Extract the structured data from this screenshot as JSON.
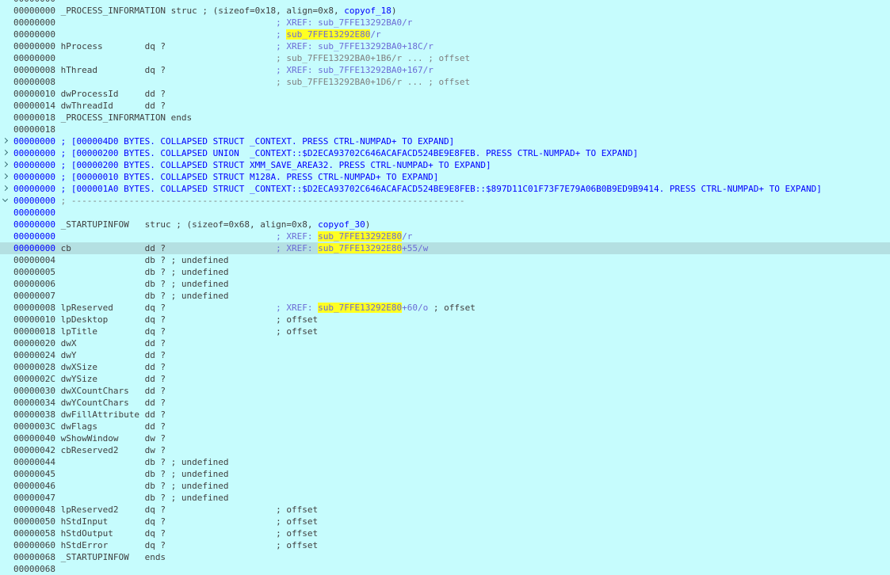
{
  "view": {
    "lines": [
      {
        "addr": "00000000",
        "blueAddr": false,
        "parts": [
          {
            "t": "",
            "c": "ln"
          }
        ]
      },
      {
        "addr": "00000000",
        "blueAddr": false,
        "parts": [
          {
            "t": " _PROCESS_INFORMATION struc ; (sizeof=0x18, align=0x8, ",
            "c": "ln"
          },
          {
            "t": "copyof_18",
            "c": "blue"
          },
          {
            "t": ")",
            "c": "ln"
          }
        ]
      },
      {
        "addr": "00000000",
        "blueAddr": false,
        "parts": [
          {
            "t": "                                          ",
            "c": "ln"
          },
          {
            "t": "; XREF: sub_7FFE13292BA0/r",
            "c": "cmt"
          }
        ]
      },
      {
        "addr": "00000000",
        "blueAddr": false,
        "parts": [
          {
            "t": "                                          ",
            "c": "ln"
          },
          {
            "t": "; ",
            "c": "cmt"
          },
          {
            "t": "sub_7FFE13292E80",
            "c": "hl"
          },
          {
            "t": "/r",
            "c": "cmt"
          }
        ]
      },
      {
        "addr": "00000000",
        "blueAddr": false,
        "parts": [
          {
            "t": " hProcess        dq ?                     ",
            "c": "ln"
          },
          {
            "t": "; XREF: sub_7FFE13292BA0+18C/r",
            "c": "cmt"
          }
        ]
      },
      {
        "addr": "00000000",
        "blueAddr": false,
        "parts": [
          {
            "t": "                                          ",
            "c": "ln"
          },
          {
            "t": "; sub_7FFE13292BA0+1B6/r ... ; offset",
            "c": "dim"
          }
        ]
      },
      {
        "addr": "00000008",
        "blueAddr": false,
        "parts": [
          {
            "t": " hThread         dq ?                     ",
            "c": "ln"
          },
          {
            "t": "; XREF: sub_7FFE13292BA0+167/r",
            "c": "cmt"
          }
        ]
      },
      {
        "addr": "00000008",
        "blueAddr": false,
        "parts": [
          {
            "t": "                                          ",
            "c": "ln"
          },
          {
            "t": "; sub_7FFE13292BA0+1D6/r ... ; offset",
            "c": "dim"
          }
        ]
      },
      {
        "addr": "00000010",
        "blueAddr": false,
        "parts": [
          {
            "t": " dwProcessId     dd ?",
            "c": "ln"
          }
        ]
      },
      {
        "addr": "00000014",
        "blueAddr": false,
        "parts": [
          {
            "t": " dwThreadId      dd ?",
            "c": "ln"
          }
        ]
      },
      {
        "addr": "00000018",
        "blueAddr": false,
        "parts": [
          {
            "t": " _PROCESS_INFORMATION ends",
            "c": "ln"
          }
        ]
      },
      {
        "addr": "00000018",
        "blueAddr": false,
        "parts": [
          {
            "t": "",
            "c": "ln"
          }
        ]
      },
      {
        "addr": "00000000",
        "blueAddr": true,
        "fold": "closed",
        "parts": [
          {
            "t": " ; [000004D0 BYTES. COLLAPSED STRUCT _CONTEXT. PRESS CTRL-NUMPAD+ TO EXPAND]",
            "c": "blue"
          }
        ]
      },
      {
        "addr": "00000000",
        "blueAddr": true,
        "fold": "closed",
        "parts": [
          {
            "t": " ; [00000200 BYTES. COLLAPSED UNION  _CONTEXT::$D2ECA93702C646ACAFACD524BE9E8FEB. PRESS CTRL-NUMPAD+ TO EXPAND]",
            "c": "blue"
          }
        ]
      },
      {
        "addr": "00000000",
        "blueAddr": true,
        "fold": "closed",
        "parts": [
          {
            "t": " ; [00000200 BYTES. COLLAPSED STRUCT XMM_SAVE_AREA32. PRESS CTRL-NUMPAD+ TO EXPAND]",
            "c": "blue"
          }
        ]
      },
      {
        "addr": "00000000",
        "blueAddr": true,
        "fold": "closed",
        "parts": [
          {
            "t": " ; [00000010 BYTES. COLLAPSED STRUCT M128A. PRESS CTRL-NUMPAD+ TO EXPAND]",
            "c": "blue"
          }
        ]
      },
      {
        "addr": "00000000",
        "blueAddr": true,
        "fold": "closed",
        "parts": [
          {
            "t": " ; [000001A0 BYTES. COLLAPSED STRUCT _CONTEXT::$D2ECA93702C646ACAFACD524BE9E8FEB::$897D11C01F73F7E79A06B0B9ED9B9414. PRESS CTRL-NUMPAD+ TO EXPAND]",
            "c": "blue"
          }
        ]
      },
      {
        "addr": "00000000",
        "blueAddr": true,
        "fold": "open",
        "parts": [
          {
            "t": " ; ---------------------------------------------------------------------------",
            "c": "dim"
          }
        ]
      },
      {
        "addr": "00000000",
        "blueAddr": true,
        "parts": [
          {
            "t": "",
            "c": "ln"
          }
        ]
      },
      {
        "addr": "00000000",
        "blueAddr": true,
        "parts": [
          {
            "t": " _STARTUPINFOW   struc ; (sizeof=0x68, align=0x8, ",
            "c": "ln"
          },
          {
            "t": "copyof_30",
            "c": "blue"
          },
          {
            "t": ")",
            "c": "ln"
          }
        ]
      },
      {
        "addr": "00000000",
        "blueAddr": true,
        "parts": [
          {
            "t": "                                          ",
            "c": "ln"
          },
          {
            "t": "; XREF: ",
            "c": "cmt"
          },
          {
            "t": "sub_7FFE13292E80",
            "c": "hl"
          },
          {
            "t": "/r",
            "c": "cmt"
          }
        ]
      },
      {
        "addr": "00000000",
        "blueAddr": true,
        "selected": true,
        "parts": [
          {
            "t": " cb              dd ?                     ",
            "c": "ln"
          },
          {
            "t": "; XREF: ",
            "c": "cmt"
          },
          {
            "t": "sub_7FFE13292E80",
            "c": "hl"
          },
          {
            "t": "+55/w",
            "c": "cmt"
          }
        ]
      },
      {
        "addr": "00000004",
        "blueAddr": false,
        "parts": [
          {
            "t": "                 db ? ; undefined",
            "c": "ln"
          }
        ]
      },
      {
        "addr": "00000005",
        "blueAddr": false,
        "parts": [
          {
            "t": "                 db ? ; undefined",
            "c": "ln"
          }
        ]
      },
      {
        "addr": "00000006",
        "blueAddr": false,
        "parts": [
          {
            "t": "                 db ? ; undefined",
            "c": "ln"
          }
        ]
      },
      {
        "addr": "00000007",
        "blueAddr": false,
        "parts": [
          {
            "t": "                 db ? ; undefined",
            "c": "ln"
          }
        ]
      },
      {
        "addr": "00000008",
        "blueAddr": false,
        "parts": [
          {
            "t": " lpReserved      dq ?                     ",
            "c": "ln"
          },
          {
            "t": "; XREF: ",
            "c": "cmt"
          },
          {
            "t": "sub_7FFE13292E80",
            "c": "hl"
          },
          {
            "t": "+60/o",
            "c": "cmt"
          },
          {
            "t": " ; offset",
            "c": "ln"
          }
        ]
      },
      {
        "addr": "00000010",
        "blueAddr": false,
        "parts": [
          {
            "t": " lpDesktop       dq ?                     ; offset",
            "c": "ln"
          }
        ]
      },
      {
        "addr": "00000018",
        "blueAddr": false,
        "parts": [
          {
            "t": " lpTitle         dq ?                     ; offset",
            "c": "ln"
          }
        ]
      },
      {
        "addr": "00000020",
        "blueAddr": false,
        "parts": [
          {
            "t": " dwX             dd ?",
            "c": "ln"
          }
        ]
      },
      {
        "addr": "00000024",
        "blueAddr": false,
        "parts": [
          {
            "t": " dwY             dd ?",
            "c": "ln"
          }
        ]
      },
      {
        "addr": "00000028",
        "blueAddr": false,
        "parts": [
          {
            "t": " dwXSize         dd ?",
            "c": "ln"
          }
        ]
      },
      {
        "addr": "0000002C",
        "blueAddr": false,
        "parts": [
          {
            "t": " dwYSize         dd ?",
            "c": "ln"
          }
        ]
      },
      {
        "addr": "00000030",
        "blueAddr": false,
        "parts": [
          {
            "t": " dwXCountChars   dd ?",
            "c": "ln"
          }
        ]
      },
      {
        "addr": "00000034",
        "blueAddr": false,
        "parts": [
          {
            "t": " dwYCountChars   dd ?",
            "c": "ln"
          }
        ]
      },
      {
        "addr": "00000038",
        "blueAddr": false,
        "parts": [
          {
            "t": " dwFillAttribute dd ?",
            "c": "ln"
          }
        ]
      },
      {
        "addr": "0000003C",
        "blueAddr": false,
        "parts": [
          {
            "t": " dwFlags         dd ?",
            "c": "ln"
          }
        ]
      },
      {
        "addr": "00000040",
        "blueAddr": false,
        "parts": [
          {
            "t": " wShowWindow     dw ?",
            "c": "ln"
          }
        ]
      },
      {
        "addr": "00000042",
        "blueAddr": false,
        "parts": [
          {
            "t": " cbReserved2     dw ?",
            "c": "ln"
          }
        ]
      },
      {
        "addr": "00000044",
        "blueAddr": false,
        "parts": [
          {
            "t": "                 db ? ; undefined",
            "c": "ln"
          }
        ]
      },
      {
        "addr": "00000045",
        "blueAddr": false,
        "parts": [
          {
            "t": "                 db ? ; undefined",
            "c": "ln"
          }
        ]
      },
      {
        "addr": "00000046",
        "blueAddr": false,
        "parts": [
          {
            "t": "                 db ? ; undefined",
            "c": "ln"
          }
        ]
      },
      {
        "addr": "00000047",
        "blueAddr": false,
        "parts": [
          {
            "t": "                 db ? ; undefined",
            "c": "ln"
          }
        ]
      },
      {
        "addr": "00000048",
        "blueAddr": false,
        "parts": [
          {
            "t": " lpReserved2     dq ?                     ; offset",
            "c": "ln"
          }
        ]
      },
      {
        "addr": "00000050",
        "blueAddr": false,
        "parts": [
          {
            "t": " hStdInput       dq ?                     ; offset",
            "c": "ln"
          }
        ]
      },
      {
        "addr": "00000058",
        "blueAddr": false,
        "parts": [
          {
            "t": " hStdOutput      dq ?                     ; offset",
            "c": "ln"
          }
        ]
      },
      {
        "addr": "00000060",
        "blueAddr": false,
        "parts": [
          {
            "t": " hStdError       dq ?                     ; offset",
            "c": "ln"
          }
        ]
      },
      {
        "addr": "00000068",
        "blueAddr": false,
        "parts": [
          {
            "t": " _STARTUPINFOW   ends",
            "c": "ln"
          }
        ]
      },
      {
        "addr": "00000068",
        "blueAddr": false,
        "parts": [
          {
            "t": "",
            "c": "ln"
          }
        ]
      }
    ]
  },
  "colors": {
    "background": "#c6fcfd",
    "selected_line": "#b4e0e2",
    "highlight": "#ffff22",
    "keyword_blue": "#0000ff",
    "comment": "#6b6bd6",
    "text": "#3f3f3f"
  },
  "icons": {
    "collapsed": "chevron-right-icon",
    "expanded": "chevron-down-icon"
  }
}
